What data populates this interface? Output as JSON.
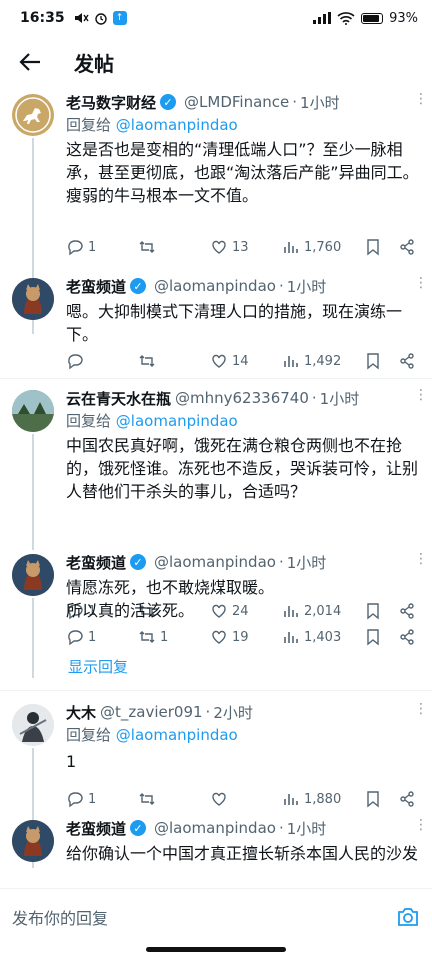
{
  "status_bar": {
    "time": "16:35",
    "battery": "93%"
  },
  "header": {
    "title": "发帖"
  },
  "tweets": [
    {
      "name": "老马数字财经",
      "handle": "@LMDFinance",
      "time": "1小时",
      "verified": true,
      "reply_to_prefix": "回复给",
      "reply_to": "@laomanpindao",
      "text": "这是否也是变相的“清理低端人口”？至少一脉相承，甚至更彻底，也跟“淘汰落后产能”异曲同工。\n瘦弱的牛马根本一文不值。",
      "replies": "1",
      "retweets": "",
      "likes": "13",
      "views": "1,760"
    },
    {
      "name": "老蛮频道",
      "handle": "@laomanpindao",
      "time": "1小时",
      "verified": true,
      "text": "嗯。大抑制模式下清理人口的措施，现在演练一下。",
      "replies": "",
      "retweets": "",
      "likes": "14",
      "views": "1,492"
    },
    {
      "name": "云在青天水在瓶",
      "handle": "@mhny62336740",
      "time": "1小时",
      "verified": false,
      "reply_to_prefix": "回复给",
      "reply_to": "@laomanpindao",
      "text": "中国农民真好啊，饿死在满仓粮仓两侧也不在抢的，饿死怪谁。冻死也不造反，哭诉装可怜，让别人替他们干杀头的事儿，合适吗？",
      "replies": "1",
      "retweets": "",
      "likes": "24",
      "views": "2,014"
    },
    {
      "name": "老蛮频道",
      "handle": "@laomanpindao",
      "time": "1小时",
      "verified": true,
      "text": "情愿冻死，也不敢烧煤取暖。\n所以真的活该死。",
      "replies": "1",
      "retweets": "1",
      "likes": "19",
      "views": "1,403"
    },
    {
      "name": "大木",
      "handle": "@t_zavier091",
      "time": "2小时",
      "verified": false,
      "reply_to_prefix": "回复给",
      "reply_to": "@laomanpindao",
      "text": "1",
      "replies": "1",
      "retweets": "",
      "likes": "",
      "views": "1,880"
    },
    {
      "name": "老蛮频道",
      "handle": "@laomanpindao",
      "time": "1小时",
      "verified": true,
      "text": "给你确认一个中国才真正擅长斩杀本国人民的沙发"
    }
  ],
  "show_replies": "显示回复",
  "compose": {
    "placeholder": "发布你的回复"
  },
  "colors": {
    "accent": "#1d9bf0",
    "text": "#0f1419",
    "muted": "#536471",
    "divider": "#eff3f4"
  }
}
